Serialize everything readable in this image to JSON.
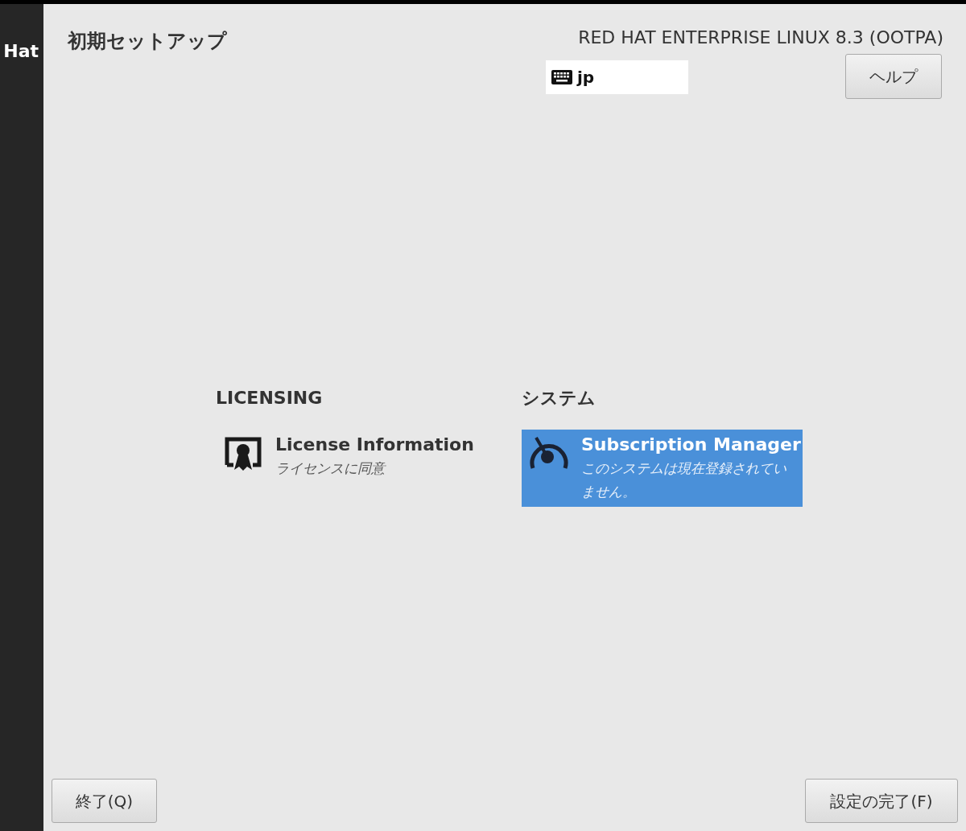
{
  "sidebar": {
    "logo_text": "Hat"
  },
  "header": {
    "title": "初期セットアップ",
    "product": "RED HAT ENTERPRISE LINUX 8.3 (OOTPA)",
    "keyboard_layout": "jp",
    "help_button": "ヘルプ"
  },
  "categories": [
    {
      "title": "LICENSING",
      "spokes": [
        {
          "kind": "license",
          "title": "License Information",
          "status": "ライセンスに同意",
          "selected": false
        }
      ]
    },
    {
      "title": "システム",
      "spokes": [
        {
          "kind": "subscription",
          "title": "Subscription Manager",
          "status": "このシステムは現在登録されていません。",
          "selected": true
        }
      ]
    }
  ],
  "footer": {
    "quit_button": "終了(Q)",
    "finish_button": "設定の完了(F)"
  }
}
